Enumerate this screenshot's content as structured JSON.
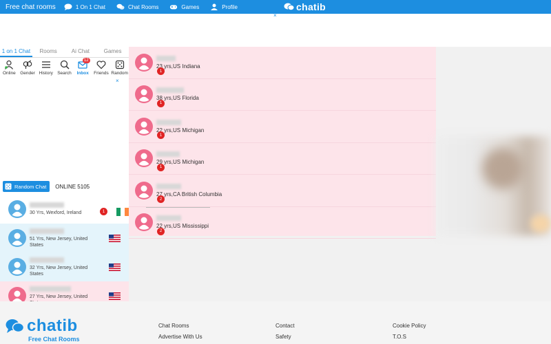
{
  "header": {
    "brand": "Free chat rooms",
    "nav": [
      "1 On 1 Chat",
      "Chat Rooms",
      "Games",
      "Profile"
    ],
    "logo": "chatib"
  },
  "close_label": "×",
  "left": {
    "tabs": [
      "1 on 1 Chat",
      "Rooms",
      "Ai Chat",
      "Games"
    ],
    "tools": [
      {
        "label": "Online",
        "icon": "online-icon"
      },
      {
        "label": "Gender",
        "icon": "gender-icon"
      },
      {
        "label": "History",
        "icon": "history-icon"
      },
      {
        "label": "Search",
        "icon": "search-icon"
      },
      {
        "label": "Inbox",
        "icon": "inbox-icon",
        "badge": "12"
      },
      {
        "label": "Friends",
        "icon": "heart-icon"
      },
      {
        "label": "Random",
        "icon": "dice-icon"
      }
    ],
    "random_button": "Random Chat",
    "online_label": "ONLINE 5105",
    "users": [
      {
        "info": "30 Yrs, Wexford, Ireland",
        "unread": "1"
      },
      {
        "info": "51 Yrs, New Jersey, United States"
      },
      {
        "info": "32 Yrs, New Jersey, United States"
      },
      {
        "info": "27 Yrs, New Jersey, United States"
      }
    ]
  },
  "conversations": [
    {
      "info": "23 yrs,US Indiana",
      "count": "1"
    },
    {
      "info": "38 yrs,US Florida",
      "count": "1"
    },
    {
      "info": "22 yrs,US Michigan",
      "count": "1"
    },
    {
      "info": "29 yrs,US Michigan",
      "count": "1"
    },
    {
      "info": "27 yrs,CA British Columbia",
      "count": "2"
    },
    {
      "info": "22 yrs,US Mississippi",
      "count": "2"
    }
  ],
  "footer": {
    "logo": "chatib",
    "tagline": "Free Chat Rooms",
    "col1": [
      "Chat Rooms",
      "Advertise With Us"
    ],
    "col2": [
      "Contact",
      "Safety"
    ],
    "col3": [
      "Cookie Policy",
      "T.O.S"
    ]
  },
  "colors": {
    "primary": "#1d8ee0",
    "male_avatar": "#5aaee3",
    "female_avatar": "#ef6b8c",
    "unread": "#e02424"
  }
}
